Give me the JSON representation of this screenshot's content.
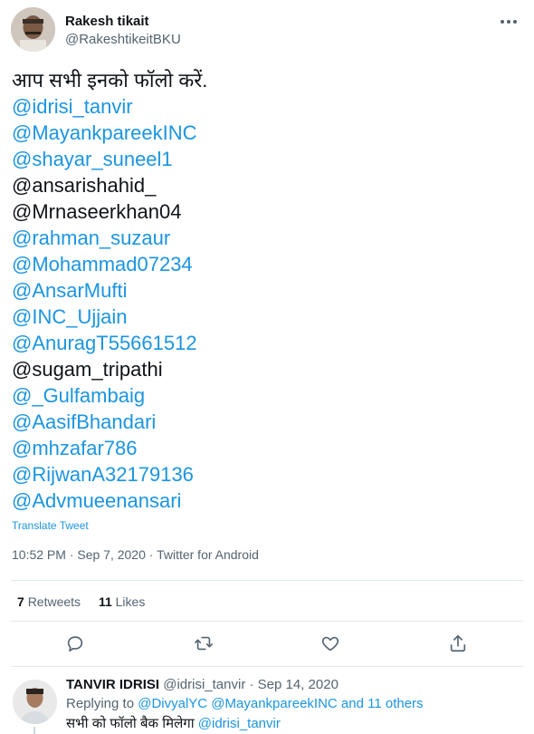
{
  "tweet": {
    "author": {
      "name": "Rakesh tikait",
      "handle": "@RakeshtikeitBKU"
    },
    "text_lines": [
      {
        "text": "आप सभी इनको फॉलो करें.",
        "mention": false
      },
      {
        "text": "@idrisi_tanvir",
        "mention": true
      },
      {
        "text": "@MayankpareekINC",
        "mention": true
      },
      {
        "text": "@shayar_suneel1",
        "mention": true
      },
      {
        "text": "@ansarishahid_",
        "mention": false
      },
      {
        "text": "@Mrnaseerkhan04",
        "mention": false
      },
      {
        "text": "@rahman_suzaur",
        "mention": true
      },
      {
        "text": "@Mohammad07234",
        "mention": true
      },
      {
        "text": "@AnsarMufti",
        "mention": true
      },
      {
        "text": "@INC_Ujjain",
        "mention": true
      },
      {
        "text": "@AnuragT55661512",
        "mention": true
      },
      {
        "text": "@sugam_tripathi",
        "mention": false
      },
      {
        "text": "@_Gulfambaig",
        "mention": true
      },
      {
        "text": "@AasifBhandari",
        "mention": true
      },
      {
        "text": "@mhzafar786",
        "mention": true
      },
      {
        "text": "@RijwanA32179136",
        "mention": true
      },
      {
        "text": "@Advmueenansari",
        "mention": true
      }
    ],
    "translate_label": "Translate Tweet",
    "meta": "10:52 PM · Sep 7, 2020 · Twitter for Android",
    "stats": {
      "retweets_count": "7",
      "retweets_label": "Retweets",
      "likes_count": "11",
      "likes_label": "Likes"
    },
    "actions": [
      {
        "name": "reply-icon"
      },
      {
        "name": "retweet-icon"
      },
      {
        "name": "like-icon"
      },
      {
        "name": "share-icon"
      }
    ],
    "link_color": "#1b95e0"
  },
  "reply": {
    "author_name": "TANVIR IDRISI",
    "author_handle": "@idrisi_tanvir",
    "separator": "·",
    "date": "Sep 14, 2020",
    "replying_prefix": "Replying to",
    "replying_to_1": "@DivyalYC",
    "replying_to_2": "@MayankpareekINC",
    "replying_and": "and",
    "replying_others": "11 others",
    "text": "सभी को फॉलो बैक मिलेगा",
    "text_mention": "@idrisi_tanvir"
  }
}
